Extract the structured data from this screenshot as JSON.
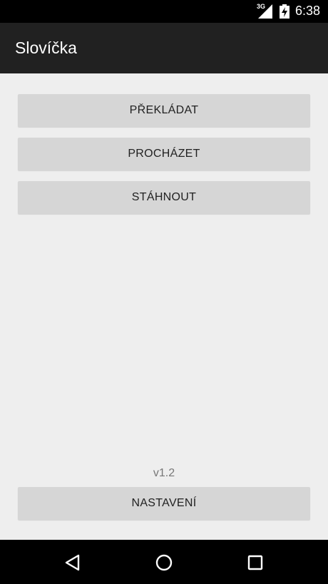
{
  "status_bar": {
    "network": "3G",
    "time": "6:38"
  },
  "action_bar": {
    "title": "Slovíčka"
  },
  "main": {
    "buttons": [
      {
        "label": "PŘEKLÁDAT"
      },
      {
        "label": "PROCHÁZET"
      },
      {
        "label": "STÁHNOUT"
      }
    ],
    "version": "v1.2",
    "settings_label": "NASTAVENÍ"
  },
  "nav_bar": {
    "icons": [
      "back-icon",
      "home-icon",
      "recents-icon"
    ]
  }
}
